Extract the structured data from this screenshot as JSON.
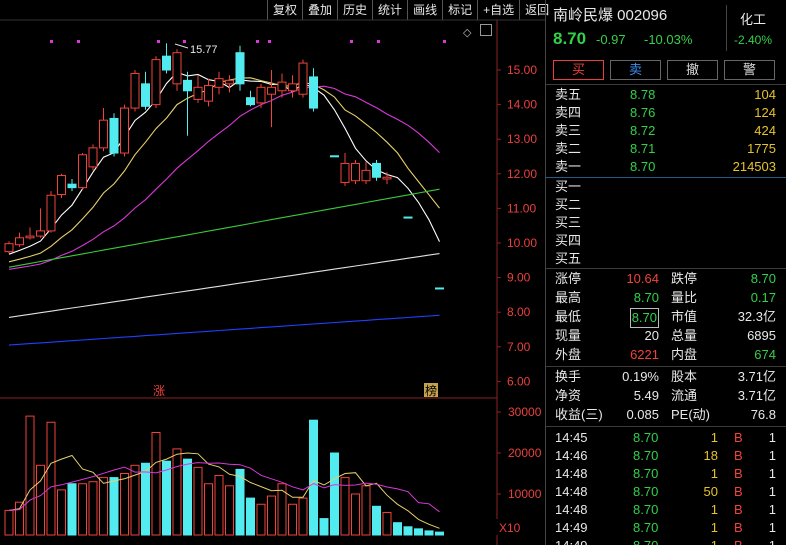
{
  "toolbar": [
    "复权",
    "叠加",
    "历史",
    "统计",
    "画线",
    "标记",
    "+自选",
    "返回"
  ],
  "chart": {
    "high_label": "15.77",
    "price_ticks": [
      "15.00",
      "14.00",
      "13.00",
      "12.00",
      "11.00",
      "10.00",
      "9.00",
      "8.00",
      "7.00",
      "6.00"
    ],
    "vol_ticks": [
      "30000",
      "20000",
      "10000"
    ],
    "vol_unit": "X10",
    "marker_zhang": "涨",
    "marker_bang": "榜",
    "candles": [
      {
        "o": 9.75,
        "h": 10.05,
        "l": 9.7,
        "c": 9.98,
        "up": true
      },
      {
        "o": 9.95,
        "h": 10.3,
        "l": 9.88,
        "c": 10.15,
        "up": true
      },
      {
        "o": 10.15,
        "h": 10.45,
        "l": 10.1,
        "c": 10.2,
        "up": true
      },
      {
        "o": 10.2,
        "h": 11.0,
        "l": 10.15,
        "c": 10.35,
        "up": true
      },
      {
        "o": 10.35,
        "h": 11.5,
        "l": 10.3,
        "c": 11.38,
        "up": true
      },
      {
        "o": 11.4,
        "h": 12.0,
        "l": 11.3,
        "c": 11.95,
        "up": true
      },
      {
        "o": 11.7,
        "h": 11.85,
        "l": 11.5,
        "c": 11.6,
        "up": false
      },
      {
        "o": 11.6,
        "h": 12.6,
        "l": 11.55,
        "c": 12.55,
        "up": true
      },
      {
        "o": 12.2,
        "h": 12.85,
        "l": 12.1,
        "c": 12.75,
        "up": true
      },
      {
        "o": 12.75,
        "h": 13.9,
        "l": 12.65,
        "c": 13.55,
        "up": true
      },
      {
        "o": 13.6,
        "h": 13.75,
        "l": 12.5,
        "c": 12.6,
        "up": false
      },
      {
        "o": 12.6,
        "h": 14.0,
        "l": 12.5,
        "c": 13.9,
        "up": true
      },
      {
        "o": 13.9,
        "h": 15.0,
        "l": 13.8,
        "c": 14.9,
        "up": true
      },
      {
        "o": 14.6,
        "h": 14.95,
        "l": 13.85,
        "c": 13.95,
        "up": false
      },
      {
        "o": 14.0,
        "h": 15.4,
        "l": 13.9,
        "c": 15.3,
        "up": true
      },
      {
        "o": 15.4,
        "h": 15.77,
        "l": 14.9,
        "c": 15.0,
        "up": false
      },
      {
        "o": 14.6,
        "h": 15.6,
        "l": 14.4,
        "c": 15.5,
        "up": true
      },
      {
        "o": 14.7,
        "h": 14.95,
        "l": 13.1,
        "c": 14.4,
        "up": false
      },
      {
        "o": 14.5,
        "h": 14.85,
        "l": 14.05,
        "c": 14.15,
        "up": true
      },
      {
        "o": 14.1,
        "h": 14.75,
        "l": 13.95,
        "c": 14.55,
        "up": true
      },
      {
        "o": 14.5,
        "h": 14.95,
        "l": 14.3,
        "c": 14.75,
        "up": true
      },
      {
        "o": 14.7,
        "h": 14.85,
        "l": 14.35,
        "c": 14.6,
        "up": true
      },
      {
        "o": 14.6,
        "h": 15.7,
        "l": 14.4,
        "c": 15.5,
        "up": false
      },
      {
        "o": 14.2,
        "h": 14.4,
        "l": 13.95,
        "c": 14.0,
        "up": false
      },
      {
        "o": 14.05,
        "h": 14.6,
        "l": 13.9,
        "c": 14.5,
        "up": true
      },
      {
        "o": 14.5,
        "h": 15.0,
        "l": 13.35,
        "c": 14.3,
        "up": true
      },
      {
        "o": 14.4,
        "h": 14.9,
        "l": 14.2,
        "c": 14.65,
        "up": true
      },
      {
        "o": 14.6,
        "h": 14.85,
        "l": 14.2,
        "c": 14.4,
        "up": true
      },
      {
        "o": 14.3,
        "h": 15.3,
        "l": 14.2,
        "c": 15.2,
        "up": true
      },
      {
        "o": 14.8,
        "h": 15.05,
        "l": 13.8,
        "c": 13.9,
        "up": false
      },
      {
        "o": null,
        "h": null,
        "l": null,
        "c": null,
        "up": false
      },
      {
        "o": 12.52,
        "h": 12.52,
        "l": 12.52,
        "c": 12.52,
        "up": false
      },
      {
        "o": 12.3,
        "h": 12.6,
        "l": 11.65,
        "c": 11.75,
        "up": true
      },
      {
        "o": 11.8,
        "h": 12.4,
        "l": 11.7,
        "c": 12.3,
        "up": true
      },
      {
        "o": 11.8,
        "h": 12.35,
        "l": 11.7,
        "c": 12.1,
        "up": true
      },
      {
        "o": 12.3,
        "h": 12.4,
        "l": 11.8,
        "c": 11.9,
        "up": false
      },
      {
        "o": 11.9,
        "h": 12.05,
        "l": 11.7,
        "c": 11.85,
        "up": true
      },
      {
        "o": null,
        "h": null,
        "l": null,
        "c": null,
        "up": false
      },
      {
        "o": 10.75,
        "h": 10.75,
        "l": 10.75,
        "c": 10.75,
        "up": false
      },
      {
        "o": null,
        "h": null,
        "l": null,
        "c": null,
        "up": false
      },
      {
        "o": null,
        "h": null,
        "l": null,
        "c": null,
        "up": false
      },
      {
        "o": 8.7,
        "h": 8.7,
        "l": 8.7,
        "c": 8.7,
        "up": false
      }
    ],
    "volumes": [
      {
        "v": 6000,
        "up": true
      },
      {
        "v": 8000,
        "up": true
      },
      {
        "v": 29000,
        "up": true
      },
      {
        "v": 17000,
        "up": true
      },
      {
        "v": 27500,
        "up": true
      },
      {
        "v": 11000,
        "up": true
      },
      {
        "v": 12500,
        "up": false
      },
      {
        "v": 12500,
        "up": true
      },
      {
        "v": 13000,
        "up": true
      },
      {
        "v": 14000,
        "up": true
      },
      {
        "v": 14000,
        "up": false
      },
      {
        "v": 15000,
        "up": true
      },
      {
        "v": 17000,
        "up": true
      },
      {
        "v": 17500,
        "up": false
      },
      {
        "v": 25000,
        "up": true
      },
      {
        "v": 18000,
        "up": false
      },
      {
        "v": 21000,
        "up": true
      },
      {
        "v": 18500,
        "up": false
      },
      {
        "v": 16500,
        "up": true
      },
      {
        "v": 12500,
        "up": true
      },
      {
        "v": 14500,
        "up": true
      },
      {
        "v": 12000,
        "up": true
      },
      {
        "v": 16000,
        "up": false
      },
      {
        "v": 9000,
        "up": false
      },
      {
        "v": 7500,
        "up": true
      },
      {
        "v": 9500,
        "up": true
      },
      {
        "v": 12500,
        "up": true
      },
      {
        "v": 7500,
        "up": true
      },
      {
        "v": 9000,
        "up": true
      },
      {
        "v": 28000,
        "up": false
      },
      {
        "v": 4000,
        "up": false
      },
      {
        "v": 20000,
        "up": false
      },
      {
        "v": 14000,
        "up": true
      },
      {
        "v": 10000,
        "up": true
      },
      {
        "v": 12000,
        "up": true
      },
      {
        "v": 7000,
        "up": false
      },
      {
        "v": 5500,
        "up": true
      },
      {
        "v": 3000,
        "up": false
      },
      {
        "v": 2000,
        "up": false
      },
      {
        "v": 1500,
        "up": false
      },
      {
        "v": 1000,
        "up": false
      },
      {
        "v": 700,
        "up": false
      }
    ]
  },
  "quote": {
    "name": "南岭民爆 002096",
    "price": "8.70",
    "change": "-0.97",
    "pct": "-10.03%",
    "sector_name": "化工",
    "sector_pct": "-2.40%"
  },
  "trade_buttons": [
    "买",
    "卖",
    "撤",
    "警"
  ],
  "asks": [
    {
      "label": "卖五",
      "price": "8.78",
      "vol": "104"
    },
    {
      "label": "卖四",
      "price": "8.76",
      "vol": "124"
    },
    {
      "label": "卖三",
      "price": "8.72",
      "vol": "424"
    },
    {
      "label": "卖二",
      "price": "8.71",
      "vol": "1775"
    },
    {
      "label": "卖一",
      "price": "8.70",
      "vol": "214503"
    }
  ],
  "bids": [
    {
      "label": "买一"
    },
    {
      "label": "买二"
    },
    {
      "label": "买三"
    },
    {
      "label": "买四"
    },
    {
      "label": "买五"
    }
  ],
  "stats1": [
    {
      "l1": "涨停",
      "v1": "10.64",
      "l2": "跌停",
      "v2": "8.70"
    },
    {
      "l1": "最高",
      "v1": "8.70",
      "l2": "量比",
      "v2": "0.17"
    },
    {
      "l1": "最低",
      "v1": "8.70",
      "l2": "市值",
      "v2": "32.3亿"
    },
    {
      "l1": "现量",
      "v1": "20",
      "l2": "总量",
      "v2": "6895"
    },
    {
      "l1": "外盘",
      "v1": "6221",
      "l2": "内盘",
      "v2": "674"
    }
  ],
  "stats2": [
    {
      "l1": "换手",
      "v1": "0.19%",
      "l2": "股本",
      "v2": "3.71亿"
    },
    {
      "l1": "净资",
      "v1": "5.49",
      "l2": "流通",
      "v2": "3.71亿"
    },
    {
      "l1": "收益(三)",
      "v1": "0.085",
      "l2": "PE(动)",
      "v2": "76.8"
    }
  ],
  "ticks": [
    {
      "time": "14:45",
      "price": "8.70",
      "vol": "1",
      "side": "B",
      "n": "1"
    },
    {
      "time": "14:46",
      "price": "8.70",
      "vol": "18",
      "side": "B",
      "n": "1"
    },
    {
      "time": "14:48",
      "price": "8.70",
      "vol": "1",
      "side": "B",
      "n": "1"
    },
    {
      "time": "14:48",
      "price": "8.70",
      "vol": "50",
      "side": "B",
      "n": "1"
    },
    {
      "time": "14:48",
      "price": "8.70",
      "vol": "1",
      "side": "B",
      "n": "1"
    },
    {
      "time": "14:49",
      "price": "8.70",
      "vol": "1",
      "side": "B",
      "n": "1"
    },
    {
      "time": "14:49",
      "price": "8.70",
      "vol": "1",
      "side": "B",
      "n": "1"
    }
  ],
  "colors": {
    "up": "#f0433a",
    "down": "#52ecf0",
    "ma5": "#ffffff",
    "ma10": "#e7d06a",
    "ma20": "#d838d8",
    "ma30": "#3bc93b",
    "ma60": "#e0e0e0",
    "ma120": "#2040ff"
  }
}
